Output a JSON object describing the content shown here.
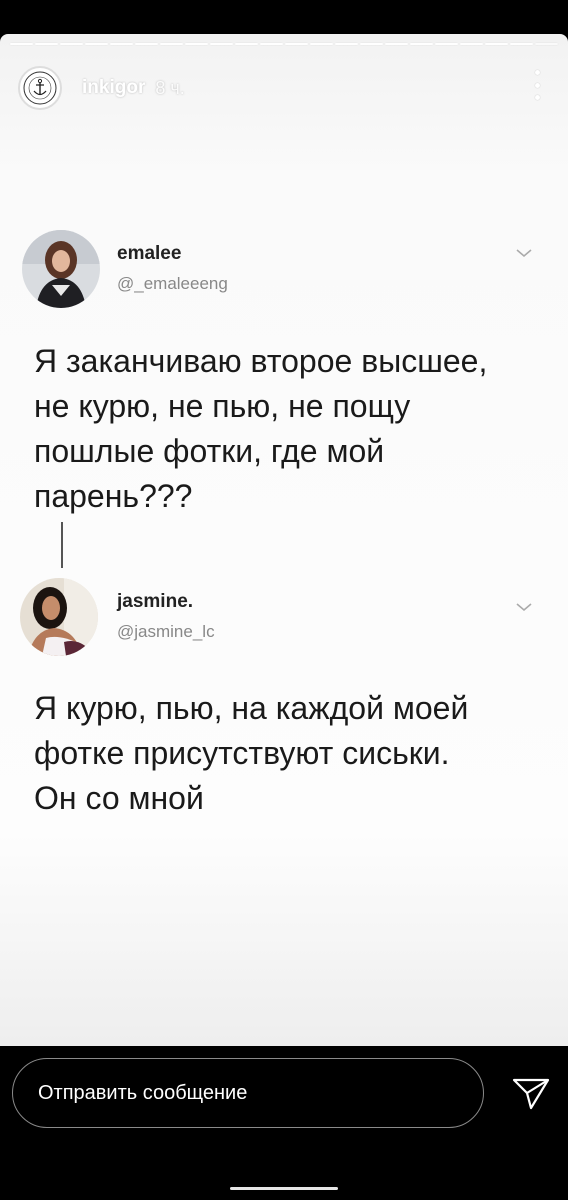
{
  "story": {
    "username": "inkigor",
    "time": "8 ч.",
    "progress": {
      "segments": 22,
      "viewed": 21
    },
    "logo_text": "INK ME ART TATTOO STUDIO"
  },
  "tweets": [
    {
      "name": "emalee",
      "handle": "@_emaleeeng",
      "lines": [
        "Я заканчиваю второе высшее,",
        "не курю, не пью, не пощу",
        "пошлые фотки, где мой",
        "парень???"
      ]
    },
    {
      "name": "jasmine.",
      "handle": "@jasmine_lc",
      "lines": [
        "Я курю, пью, на каждой моей",
        "фотке присутствуют сиськи.",
        "Он со мной"
      ]
    }
  ],
  "reply": {
    "placeholder": "Отправить сообщение"
  },
  "colors": {
    "background": "#000000",
    "story_bg": "#f7f7f7",
    "text": "#1a1a1a",
    "handle": "#888888"
  }
}
